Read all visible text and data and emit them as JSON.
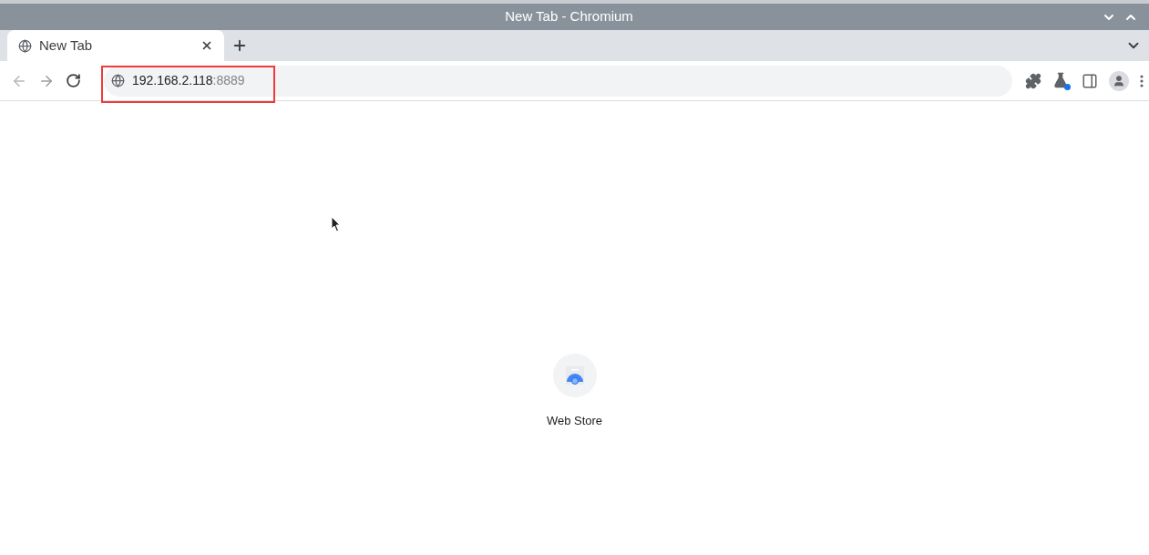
{
  "window": {
    "title": "New Tab - Chromium"
  },
  "tabs": [
    {
      "label": "New Tab",
      "selected": true
    }
  ],
  "address_bar": {
    "host": "192.168.2.118",
    "port": ":8889",
    "highlighted": true
  },
  "shortcuts": [
    {
      "label": "Web Store"
    }
  ]
}
